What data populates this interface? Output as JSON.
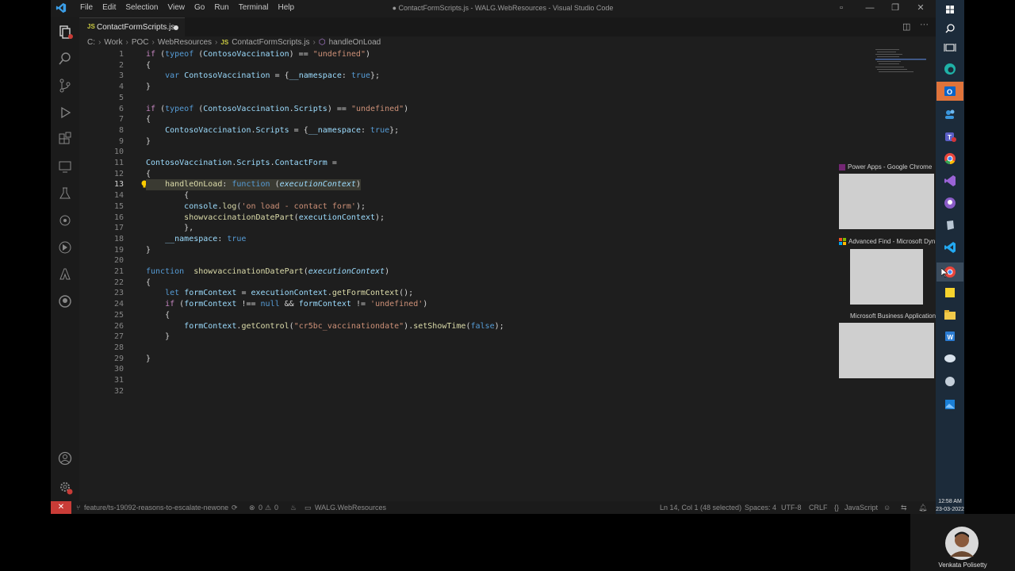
{
  "titlebar": {
    "menu": [
      "File",
      "Edit",
      "Selection",
      "View",
      "Go",
      "Run",
      "Terminal",
      "Help"
    ],
    "window_title": "● ContactFormScripts.js - WALG.WebResources - Visual Studio Code"
  },
  "tab": {
    "label": "ContactFormScripts.js",
    "lang_badge": "JS"
  },
  "breadcrumb": [
    "C:",
    "Work",
    "POC",
    "WebResources",
    "ContactFormScripts.js",
    "handleOnLoad"
  ],
  "editor": {
    "line_numbers": [
      "1",
      "2",
      "3",
      "4",
      "5",
      "6",
      "7",
      "8",
      "9",
      "10",
      "11",
      "12",
      "13",
      "14",
      "15",
      "16",
      "17",
      "18",
      "19",
      "20",
      "21",
      "22",
      "23",
      "24",
      "25",
      "26",
      "27",
      "28",
      "29",
      "30",
      "31",
      "32"
    ],
    "current_line": "13"
  },
  "statusbar": {
    "branch": "feature/ts-19092-reasons-to-escalate-newone",
    "errors": "0",
    "warnings": "0",
    "folder": "WALG.WebResources",
    "position": "Ln 14, Col 1 (48 selected)",
    "spaces": "Spaces: 4",
    "encoding": "UTF-8",
    "eol": "CRLF",
    "language": "JavaScript"
  },
  "thumbnails": [
    {
      "title": "Power Apps - Google Chrome"
    },
    {
      "title": "Advanced Find - Microsoft Dyn..."
    },
    {
      "title": "Microsoft Business Application..."
    }
  ],
  "clock": {
    "time": "12:58 AM",
    "date": "23-03-2022"
  },
  "webcam": {
    "name": "Venkata Polisetty"
  },
  "colors": {
    "accent_blue": "#0078d4",
    "remote_red": "#c93c37",
    "editor_bg": "#1e1e1e"
  }
}
